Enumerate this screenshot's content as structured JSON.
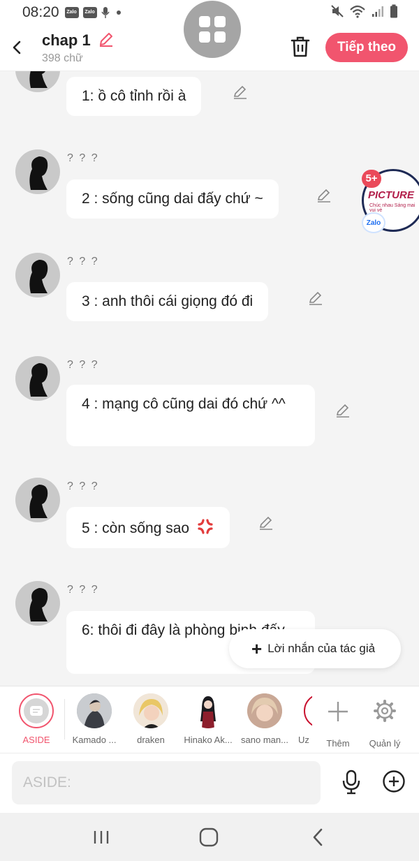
{
  "status_bar": {
    "time": "08:20",
    "badge_1": "Zalo",
    "badge_2": "Zalo"
  },
  "header": {
    "title": "chap 1",
    "word_count": "398 chữ",
    "next_button": "Tiếp theo"
  },
  "messages": [
    {
      "name": "",
      "text": "1: ồ cô tỉnh rồi à"
    },
    {
      "name": "? ? ?",
      "text": "2 : sống cũng dai đấy chứ ~"
    },
    {
      "name": "? ? ?",
      "text": "3 : anh thôi cái giọng đó đi"
    },
    {
      "name": "? ? ?",
      "text": "4 : mạng cô cũng dai đó chứ ^^"
    },
    {
      "name": "? ? ?",
      "text": "5 : còn sống sao"
    },
    {
      "name": "? ? ?",
      "text": "6: thôi đi đây là phòng bịnh đấy"
    }
  ],
  "floating_badge": {
    "count": "5+",
    "label": "PICTURE",
    "subtext": "Chúc nhau Sáng mai vui vẻ",
    "app": "Zalo"
  },
  "author_note_button": "Lời nhắn của tác giả",
  "characters": [
    {
      "name": "ASIDE",
      "selected": true
    },
    {
      "name": "Kamado ..."
    },
    {
      "name": "draken"
    },
    {
      "name": "Hinako Ak..."
    },
    {
      "name": "sano man..."
    },
    {
      "name": "Uz"
    }
  ],
  "char_actions": {
    "add_label": "Thêm",
    "manage_label": "Quản lý"
  },
  "input": {
    "placeholder": "ASIDE:"
  },
  "colors": {
    "accent": "#f1556e",
    "background": "#f4f4f4"
  },
  "icons": [
    "back-icon",
    "edit-icon",
    "trash-icon",
    "grid-icon",
    "plus-icon",
    "gear-icon",
    "mic-icon",
    "add-circle-icon",
    "recent-apps-icon",
    "home-icon",
    "nav-back-icon"
  ]
}
